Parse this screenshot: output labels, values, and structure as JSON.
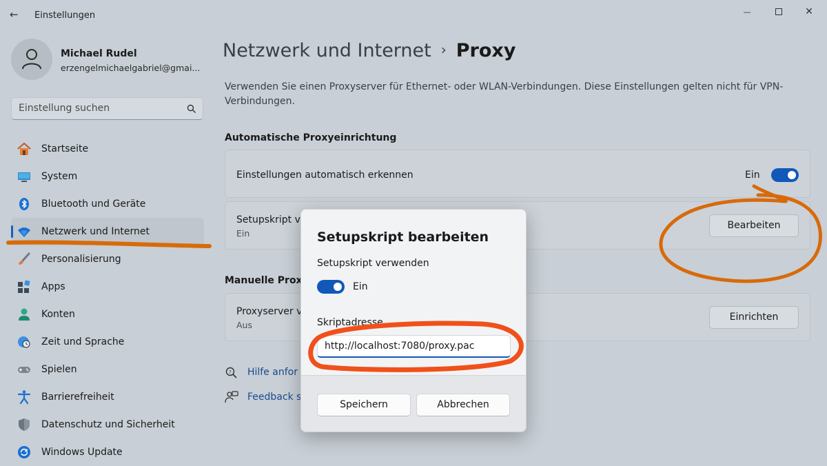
{
  "window": {
    "title": "Einstellungen",
    "back_glyph": "←",
    "minimize_glyph": "—",
    "close_glyph": "✕"
  },
  "profile": {
    "name": "Michael Rudel",
    "email": "erzengelmichaelgabriel@gmai..."
  },
  "search": {
    "placeholder": "Einstellung suchen"
  },
  "sidebar": {
    "items": [
      {
        "label": "Startseite",
        "icon": "home-icon"
      },
      {
        "label": "System",
        "icon": "monitor-icon"
      },
      {
        "label": "Bluetooth und Geräte",
        "icon": "bluetooth-icon"
      },
      {
        "label": "Netzwerk und Internet",
        "icon": "wifi-icon",
        "active": true
      },
      {
        "label": "Personalisierung",
        "icon": "brush-icon"
      },
      {
        "label": "Apps",
        "icon": "apps-icon"
      },
      {
        "label": "Konten",
        "icon": "person-icon"
      },
      {
        "label": "Zeit und Sprache",
        "icon": "globe-clock-icon"
      },
      {
        "label": "Spielen",
        "icon": "gamepad-icon"
      },
      {
        "label": "Barrierefreiheit",
        "icon": "accessibility-icon"
      },
      {
        "label": "Datenschutz und Sicherheit",
        "icon": "shield-icon"
      },
      {
        "label": "Windows Update",
        "icon": "update-icon"
      }
    ]
  },
  "main": {
    "breadcrumb_parent": "Netzwerk und Internet",
    "breadcrumb_separator": "›",
    "breadcrumb_current": "Proxy",
    "description": "Verwenden Sie einen Proxyserver für Ethernet- oder WLAN-Verbindungen. Diese Einstellungen gelten nicht für VPN-Verbindungen.",
    "auto_section_title": "Automatische Proxyeinrichtung",
    "auto_detect": {
      "label": "Einstellungen automatisch erkennen",
      "state": "Ein"
    },
    "setup_script": {
      "label": "Setupskript v",
      "status": "Ein",
      "button": "Bearbeiten"
    },
    "manual_section_title": "Manuelle Proxy",
    "proxy_server": {
      "label": "Proxyserver v",
      "status": "Aus",
      "button": "Einrichten"
    },
    "links": {
      "help": "Hilfe anfor",
      "feedback": "Feedback s"
    }
  },
  "dialog": {
    "title": "Setupskript bearbeiten",
    "use_script_label": "Setupskript verwenden",
    "toggle_state": "Ein",
    "address_label": "Skriptadresse",
    "address_value": "http://localhost:7080/proxy.pac",
    "save_button": "Speichern",
    "cancel_button": "Abbrechen"
  },
  "colors": {
    "accent": "#1258b8",
    "annotation_orange": "#d86a0a",
    "annotation_red_orange": "#f0501a"
  }
}
